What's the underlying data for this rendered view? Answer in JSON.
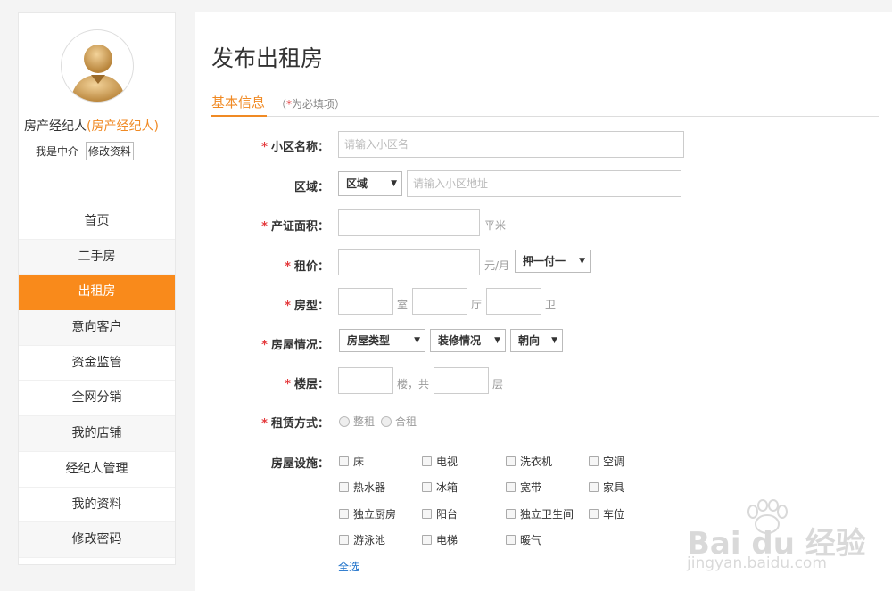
{
  "profile": {
    "name": "房产经纪人",
    "role": "(房产经纪人)",
    "sub_label": "我是中介",
    "edit_button": "修改资料"
  },
  "menu": [
    {
      "label": "首页",
      "state": "normal"
    },
    {
      "label": "二手房",
      "state": "gray"
    },
    {
      "label": "出租房",
      "state": "active"
    },
    {
      "label": "意向客户",
      "state": "gray"
    },
    {
      "label": "资金监管",
      "state": "normal"
    },
    {
      "label": "全网分销",
      "state": "normal"
    },
    {
      "label": "我的店铺",
      "state": "gray"
    },
    {
      "label": "经纪人管理",
      "state": "normal"
    },
    {
      "label": "我的资料",
      "state": "normal"
    },
    {
      "label": "修改密码",
      "state": "gray"
    }
  ],
  "page_title": "发布出租房",
  "tab": {
    "label": "基本信息",
    "note_prefix": "（",
    "note_star": "*",
    "note_text": "为必填项）"
  },
  "form": {
    "community": {
      "label": "小区名称：",
      "placeholder": "请输入小区名"
    },
    "district": {
      "label": "区域：",
      "select": "区域",
      "placeholder": "请输入小区地址"
    },
    "area": {
      "label": "产证面积：",
      "value": "",
      "unit": "平米"
    },
    "rent": {
      "label": "租价：",
      "value": "",
      "unit": "元/月",
      "payment_select": "押一付一"
    },
    "layout": {
      "label": "房型：",
      "unit_room": "室",
      "unit_hall": "厅",
      "unit_bath": "卫"
    },
    "condition": {
      "label": "房屋情况：",
      "type_select": "房屋类型",
      "decor_select": "装修情况",
      "orient_select": "朝向"
    },
    "floor": {
      "label": "楼层：",
      "unit_floor": "楼，共",
      "unit_total": "层"
    },
    "lease": {
      "label": "租赁方式：",
      "options": [
        "整租",
        "合租"
      ]
    },
    "facilities": {
      "label": "房屋设施：",
      "items": [
        "床",
        "电视",
        "洗衣机",
        "空调",
        "热水器",
        "冰箱",
        "宽带",
        "家具",
        "独立厨房",
        "阳台",
        "独立卫生间",
        "车位",
        "游泳池",
        "电梯",
        "暖气"
      ],
      "select_all": "全选"
    }
  },
  "required_mark": "*",
  "caret": "▼",
  "watermark": {
    "text": "Bai du 经验",
    "url": "jingyan.baidu.com"
  },
  "colors": {
    "accent": "#f98a1b",
    "required": "#e4393c",
    "link": "#1a6fc9"
  }
}
